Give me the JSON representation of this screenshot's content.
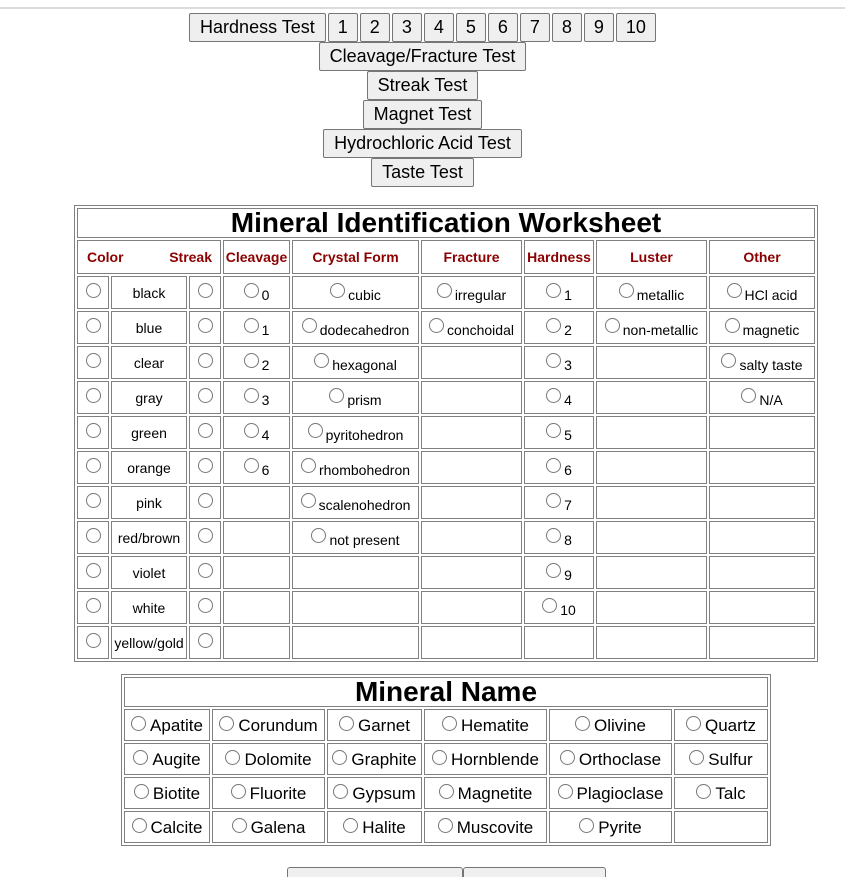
{
  "toolbar": {
    "hardness_test_label": "Hardness Test",
    "hardness_numbers": [
      "1",
      "2",
      "3",
      "4",
      "5",
      "6",
      "7",
      "8",
      "9",
      "10"
    ],
    "cleavage_fracture_label": "Cleavage/Fracture Test",
    "streak_label": "Streak Test",
    "magnet_label": "Magnet Test",
    "hcl_label": "Hydrochloric Acid Test",
    "taste_label": "Taste Test"
  },
  "worksheet": {
    "title": "Mineral Identification Worksheet",
    "headers": {
      "color": "Color",
      "streak": "Streak",
      "cleavage": "Cleavage",
      "crystal_form": "Crystal Form",
      "fracture": "Fracture",
      "hardness": "Hardness",
      "luster": "Luster",
      "other": "Other"
    },
    "header_color": "#8b0000",
    "colors": [
      "black",
      "blue",
      "clear",
      "gray",
      "green",
      "orange",
      "pink",
      "red/brown",
      "violet",
      "white",
      "yellow/gold"
    ],
    "cleavage": [
      "0",
      "1",
      "2",
      "3",
      "4",
      "6"
    ],
    "crystal_form": [
      "cubic",
      "dodecahedron",
      "hexagonal",
      "prism",
      "pyritohedron",
      "rhombohedron",
      "scalenohedron",
      "not present"
    ],
    "fracture": [
      "irregular",
      "conchoidal"
    ],
    "hardness": [
      "1",
      "2",
      "3",
      "4",
      "5",
      "6",
      "7",
      "8",
      "9",
      "10"
    ],
    "luster": [
      "metallic",
      "non-metallic"
    ],
    "other": [
      "HCl acid",
      "magnetic",
      "salty taste",
      "N/A"
    ]
  },
  "mineral_name": {
    "title": "Mineral Name",
    "rows": [
      [
        "Apatite",
        "Corundum",
        "Garnet",
        "Hematite",
        "Olivine",
        "Quartz"
      ],
      [
        "Augite",
        "Dolomite",
        "Graphite",
        "Hornblende",
        "Orthoclase",
        "Sulfur"
      ],
      [
        "Biotite",
        "Fluorite",
        "Gypsum",
        "Magnetite",
        "Plagioclase",
        "Talc"
      ],
      [
        "Calcite",
        "Galena",
        "Halite",
        "Muscovite",
        "Pyrite",
        ""
      ]
    ]
  }
}
